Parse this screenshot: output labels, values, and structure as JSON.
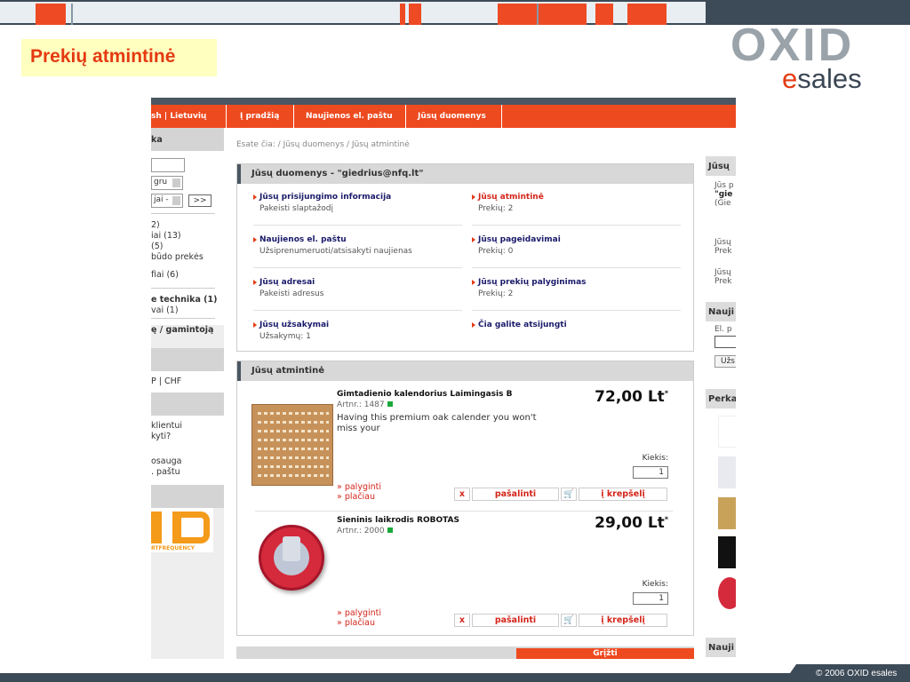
{
  "slide": {
    "title": "Prekių atmintinė",
    "logo": {
      "oxid": "OXID",
      "e": "e",
      "sales": "sales"
    },
    "footer": "© 2006 OXID esales"
  },
  "colors": {
    "accent": "#ee4a1f",
    "dark": "#3d4a57",
    "title_bg": "#ffffc0"
  },
  "screenshot": {
    "nav": {
      "lang_cut": "sh | Lietuvių",
      "items": [
        "Į pradžią",
        "Naujienos el. paštu",
        "Jūsų duomenys"
      ]
    },
    "left": {
      "header1": "ka",
      "select1": "gru",
      "select2": "jai -",
      "go": ">>",
      "cats": [
        "2)",
        "iai (13)",
        "(5)",
        " būdo prekės",
        "fiai (6)",
        "e technika (1)",
        "vai (1)",
        "ę / gamintoją"
      ],
      "currency": "P | CHF",
      "info": [
        "klientui",
        "kyti?",
        "osauga",
        ". paštu"
      ],
      "partner": "RTFREQUENCY"
    },
    "breadcrumb": "Esate čia: / Jūsų duomenys / Jūsų atmintinė",
    "account": {
      "title": "Jūsų duomenys - \"giedrius@nfq.lt\"",
      "items": [
        {
          "link": "Jūsų prisijungimo informacija",
          "sub": "Pakeisti slaptažodį"
        },
        {
          "link": "Jūsų atmintinė",
          "sub": "Prekių: 2"
        },
        {
          "link": "Naujienos el. paštu",
          "sub": "Užsiprenumeruoti/atsisakyti naujienas"
        },
        {
          "link": "Jūsų pageidavimai",
          "sub": "Prekių: 0"
        },
        {
          "link": "Jūsų adresai",
          "sub": "Pakeisti adresus"
        },
        {
          "link": "Jūsų prekių palyginimas",
          "sub": "Prekių: 2"
        },
        {
          "link": "Jūsų užsakymai",
          "sub": "Užsakymų: 1"
        },
        {
          "link": "Čia galite atsijungti",
          "sub": ""
        }
      ]
    },
    "notice": {
      "title": "Jūsų atmintinė",
      "products": [
        {
          "name": "Gimtadienio kalendorius Laimingasis B",
          "artnr": "Artnr.: 1487",
          "desc": "Having this premium oak calender you won't miss your",
          "price": "72,00 Lt",
          "star": "*",
          "qty_label": "Kiekis:",
          "qty": "1",
          "compare": "» palyginti",
          "more": "» plačiau",
          "x": "x",
          "remove": "pašalinti",
          "cart_icon": "cart-icon",
          "to_cart": "į krepšelį"
        },
        {
          "name": "Sieninis laikrodis ROBOTAS",
          "artnr": "Artnr.: 2000",
          "desc": "",
          "price": "29,00 Lt",
          "star": "*",
          "qty_label": "Kiekis:",
          "qty": "1",
          "compare": "» palyginti",
          "more": "» plačiau",
          "x": "x",
          "remove": "pašalinti",
          "cart_icon": "cart-icon",
          "to_cart": "į krepšelį"
        }
      ]
    },
    "back": "Grįžti",
    "right": {
      "h1": "Jūsų",
      "lines1": [
        "Jūs p",
        "\"gie",
        "(Gie"
      ],
      "lines2": [
        "Jūsų",
        "Prek",
        "Jūsų",
        "Prek"
      ],
      "h2": "Nauji",
      "el": "El. p",
      "subbtn": "Užs",
      "h3": "Perka",
      "h4": "Nauji"
    }
  }
}
